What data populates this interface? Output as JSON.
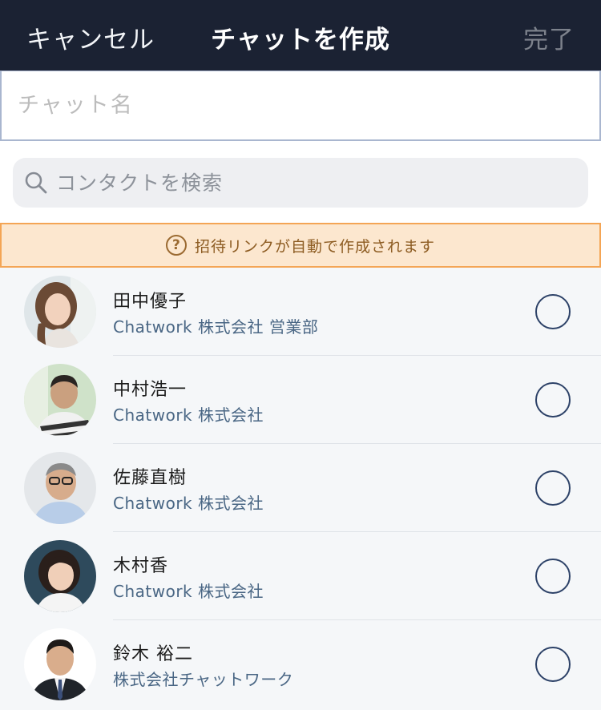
{
  "header": {
    "cancel_label": "キャンセル",
    "title": "チャットを作成",
    "done_label": "完了"
  },
  "chat_name": {
    "placeholder": "チャット名",
    "value": ""
  },
  "search": {
    "placeholder": "コンタクトを検索",
    "value": ""
  },
  "notice": {
    "icon": "question-circle-icon",
    "text": "招待リンクが自動で作成されます"
  },
  "contacts": [
    {
      "name": "田中優子",
      "org": "Chatwork 株式会社 営業部",
      "selected": false
    },
    {
      "name": "中村浩一",
      "org": "Chatwork 株式会社",
      "selected": false
    },
    {
      "name": "佐藤直樹",
      "org": "Chatwork 株式会社",
      "selected": false
    },
    {
      "name": "木村香",
      "org": "Chatwork 株式会社",
      "selected": false
    },
    {
      "name": "鈴木 裕二",
      "org": "株式会社チャットワーク",
      "selected": false
    }
  ],
  "colors": {
    "header_bg": "#1b2233",
    "notice_bg": "#fce7cf",
    "notice_border": "#f4a555",
    "org_text": "#496684",
    "check_border": "#2d4268"
  }
}
